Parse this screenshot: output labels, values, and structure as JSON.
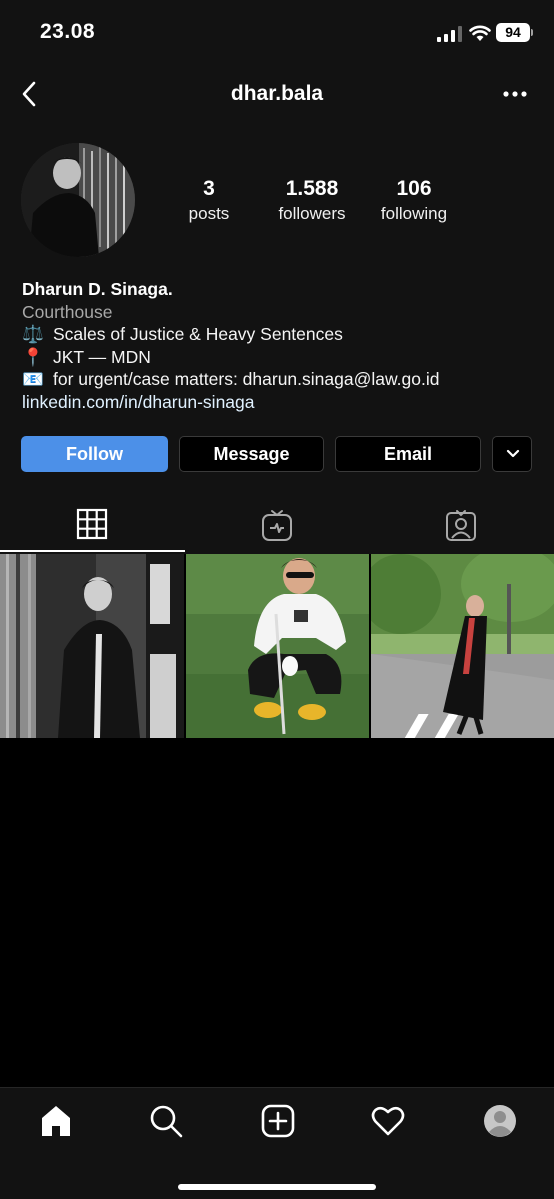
{
  "status_bar": {
    "time": "23.08",
    "battery": "94"
  },
  "header": {
    "username": "dhar.bala",
    "back_icon": "chevron-left-icon",
    "more_icon": "ellipsis-icon"
  },
  "profile": {
    "stats": [
      {
        "number": "3",
        "label": "posts"
      },
      {
        "number": "1.588",
        "label": "followers"
      },
      {
        "number": "106",
        "label": "following"
      }
    ],
    "name": "Dharun D. Sinaga.",
    "category": "Courthouse",
    "bio_lines": [
      {
        "emoji": "⚖️",
        "text": "Scales of Justice & Heavy Sentences"
      },
      {
        "emoji": "📍",
        "text": "JKT — MDN"
      },
      {
        "emoji": "📧",
        "text": "for urgent/case matters: dharun.sinaga@law.go.id"
      }
    ],
    "link": "linkedin.com/in/dharun-sinaga"
  },
  "actions": {
    "follow": "Follow",
    "message": "Message",
    "email": "Email"
  },
  "tabs": [
    "grid-icon",
    "igtv-icon",
    "tagged-icon"
  ],
  "colors": {
    "accent": "#4c90e8",
    "background": "#121212"
  },
  "bottom_nav": [
    "home-icon",
    "search-icon",
    "add-icon",
    "heart-icon",
    "profile-icon"
  ]
}
